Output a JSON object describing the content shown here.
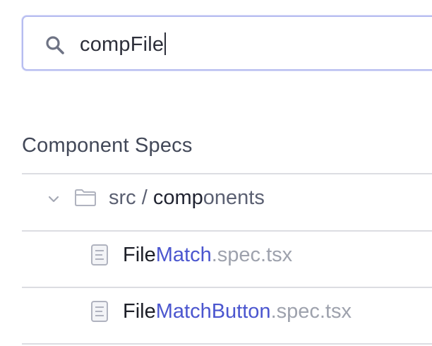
{
  "search": {
    "query": "compFile"
  },
  "section": {
    "title": "Component Specs"
  },
  "folder": {
    "path_prefix": "src / ",
    "path_match": "comp",
    "path_rest": "onents",
    "icon": "folder-icon",
    "expanded": true
  },
  "files": [
    {
      "match_dark": "File",
      "match_blue": "Match",
      "extension": ".spec.tsx",
      "icon": "file-icon"
    },
    {
      "match_dark": "File",
      "match_blue": "MatchButton",
      "extension": ".spec.tsx",
      "icon": "file-icon"
    }
  ],
  "colors": {
    "accent": "#4b56cf",
    "search_border": "#b7bdf0",
    "divider": "#dcdde2"
  }
}
